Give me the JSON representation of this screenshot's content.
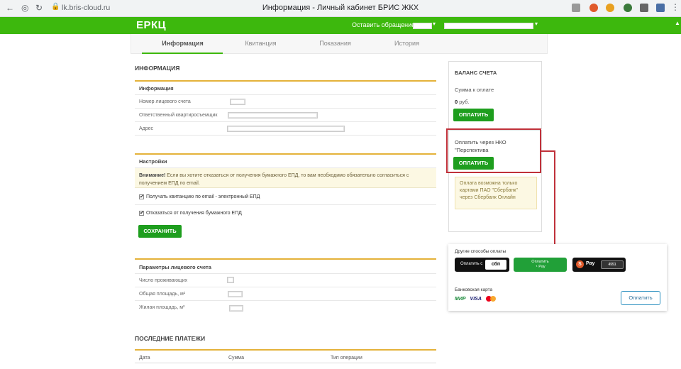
{
  "browser": {
    "url": "lk.bris-cloud.ru",
    "title": "Информация - Личный кабинет БРИС ЖКХ"
  },
  "header": {
    "brand": "ЕРКЦ",
    "feedback": "Оставить обращение"
  },
  "tabs": [
    {
      "label": "Информация",
      "active": true
    },
    {
      "label": "Квитанция"
    },
    {
      "label": "Показания"
    },
    {
      "label": "История"
    }
  ],
  "info": {
    "heading": "ИНФОРМАЦИЯ",
    "panel_title": "Информация",
    "rows": [
      "Номер лицевого счета",
      "Ответственный квартиросъемщик",
      "Адрес"
    ]
  },
  "settings": {
    "title": "Настройки",
    "warn_bold": "Внимание!",
    "warn_text": " Если вы хотите отказаться от получения бумажного ЕПД, то вам необходимо обязательно согласиться с получением ЕПД по email.",
    "cb1": "Получать квитанцию по email - электронный ЕПД",
    "cb2": "Отказаться от получения бумажного ЕПД",
    "save": "СОХРАНИТЬ"
  },
  "params": {
    "title": "Параметры лицевого счета",
    "rows": [
      "Число проживающих",
      "Общая площадь, м²",
      "Жилая площадь, м²"
    ]
  },
  "payments": {
    "heading": "ПОСЛЕДНИЕ ПЛАТЕЖИ",
    "cols": [
      "Дата",
      "Сумма",
      "Тип операции"
    ]
  },
  "balance": {
    "title": "БАЛАНС СЧЕТА",
    "sum_label": "Сумма к оплате",
    "amount": "0",
    "currency": " руб.",
    "pay": "ОПЛАТИТЬ"
  },
  "nko": {
    "text": "Оплатить через НКО \"Перспектива",
    "pay": "ОПЛАТИТЬ",
    "note": "Оплата возможна только картами ПАО \"Сбербанк\" через Сбербанк Онлайн"
  },
  "paywidget": {
    "other": "Другие способы оплаты",
    "sbp_label": "Оплатить с",
    "sbp_logo": "сбп",
    "sber_label": "Оплатить",
    "sber_pay": "Pay",
    "spay": "Pay",
    "spay_card": "4551",
    "bank": "Банковская карта",
    "mir": "МИР",
    "visa": "VISA",
    "pay": "Оплатить"
  },
  "colors": {
    "brand_green": "#3db80d",
    "accent_gold": "#e4b23a",
    "highlight_red": "#c0313a"
  }
}
